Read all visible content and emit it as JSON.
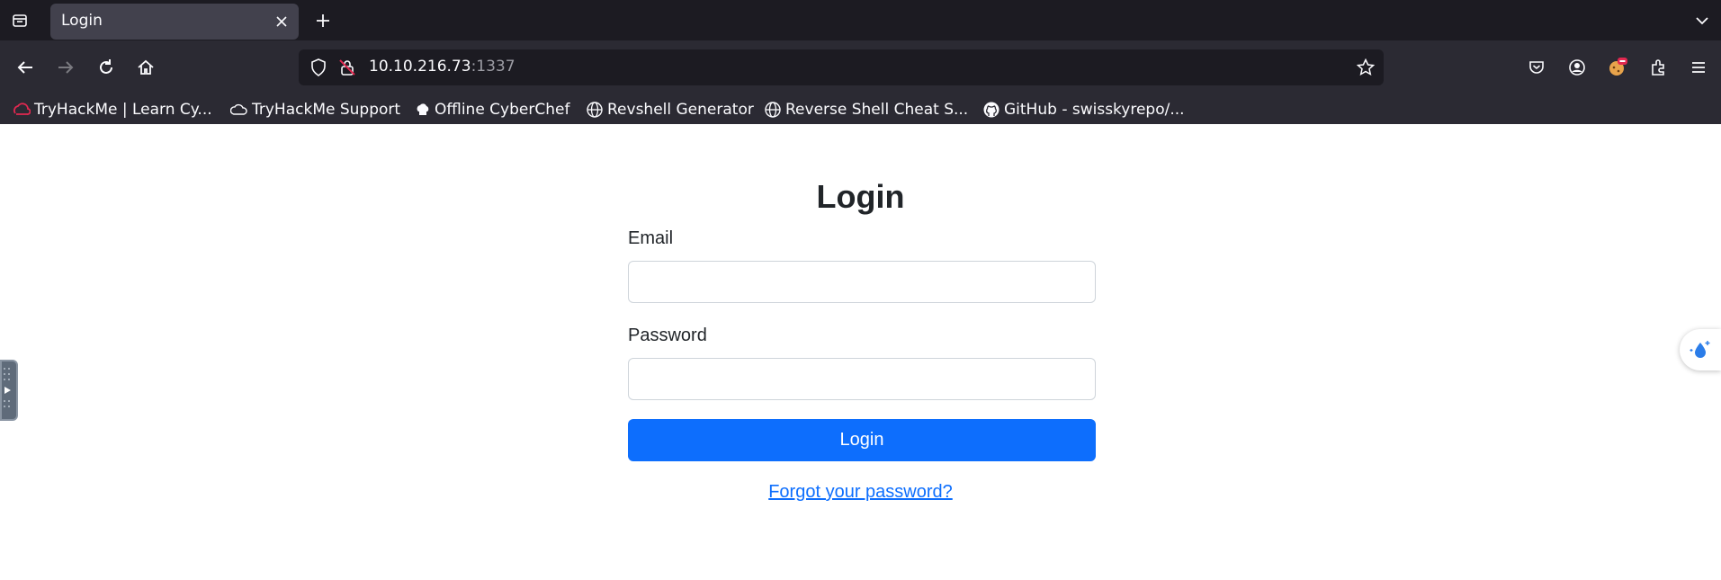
{
  "browser": {
    "tab": {
      "title": "Login"
    },
    "url": {
      "host": "10.10.216.73",
      "port": ":1337"
    },
    "bookmarks": [
      {
        "label": "TryHackMe | Learn Cy...",
        "icon": "tryhackme-icon"
      },
      {
        "label": "TryHackMe Support",
        "icon": "cloud-icon"
      },
      {
        "label": "Offline CyberChef",
        "icon": "chef-hat-icon"
      },
      {
        "label": "Revshell Generator",
        "icon": "globe-icon"
      },
      {
        "label": "Reverse Shell Cheat S...",
        "icon": "globe-icon"
      },
      {
        "label": "GitHub - swisskyrepo/...",
        "icon": "github-icon"
      }
    ]
  },
  "page": {
    "title": "Login",
    "email_label": "Email",
    "email_value": "",
    "password_label": "Password",
    "password_value": "",
    "login_button": "Login",
    "forgot_link": "Forgot your password?"
  },
  "colors": {
    "primary": "#0d6efd",
    "chrome_dark": "#1c1b22",
    "toolbar": "#2b2a33"
  }
}
